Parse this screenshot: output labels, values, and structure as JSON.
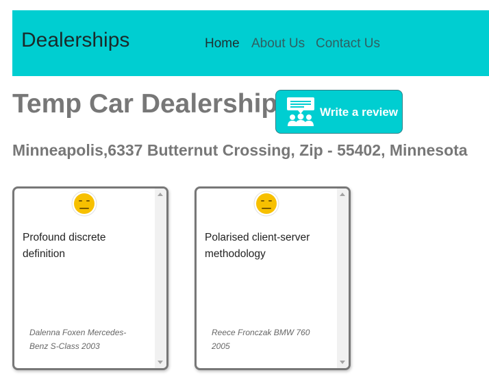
{
  "nav": {
    "brand": "Dealerships",
    "links": [
      "Home",
      "About Us",
      "Contact Us"
    ],
    "active": "Home"
  },
  "dealer": {
    "name": "Temp Car Dealership",
    "address": "Minneapolis,6337 Butternut Crossing, Zip - 55402, Minnesota"
  },
  "review_button": {
    "label": "Write a review",
    "icon": "review-chat-icon"
  },
  "reviews": [
    {
      "sentiment_icon": "neutral-face-icon",
      "text": "Profound discrete definition",
      "meta": "Dalenna Foxen Mercedes-Benz S-Class 2003"
    },
    {
      "sentiment_icon": "neutral-face-icon",
      "text": "Polarised client-server methodology",
      "meta": "Reece Fronczak BMW 760 2005"
    }
  ],
  "colors": {
    "navbar": "#00ced1",
    "heading": "#777777",
    "button_border": "#2e7f86",
    "emoji": "#f7c000"
  }
}
